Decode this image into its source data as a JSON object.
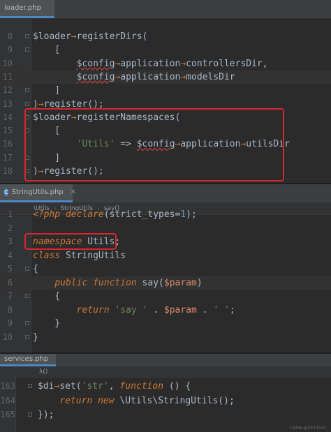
{
  "panes": [
    {
      "tab": {
        "label": "loader.php",
        "icon": "php-file-icon",
        "close": "✕"
      },
      "lines": [
        {
          "num": "8",
          "code": "$loader->registerDirs("
        },
        {
          "num": "9",
          "code": "    ["
        },
        {
          "num": "10",
          "code": "        $config->application->controllersDir,"
        },
        {
          "num": "11",
          "code": "        $config->application->modelsDir"
        },
        {
          "num": "12",
          "code": "    ]"
        },
        {
          "num": "13",
          "code": ")->register();"
        },
        {
          "num": "14",
          "code": "$loader->registerNamespaces("
        },
        {
          "num": "15",
          "code": "    ["
        },
        {
          "num": "16",
          "code": "        'Utils' => $config->application->utilsDir"
        },
        {
          "num": "17",
          "code": "    ]"
        },
        {
          "num": "18",
          "code": ")->register();"
        }
      ]
    },
    {
      "tab": {
        "label": "StringUtils.php",
        "icon": "class-file-icon",
        "icon_letter": "C",
        "close": "✕"
      },
      "breadcrumb": [
        "\\Utils",
        "StringUtils",
        "say()"
      ],
      "breadcrumb_sep": "›",
      "lines": [
        {
          "num": "1",
          "code": "<?php declare(strict_types=1);"
        },
        {
          "num": "2",
          "code": ""
        },
        {
          "num": "3",
          "code": "namespace Utils;"
        },
        {
          "num": "4",
          "code": "class StringUtils"
        },
        {
          "num": "5",
          "code": "{"
        },
        {
          "num": "6",
          "code": "    public function say($param)"
        },
        {
          "num": "7",
          "code": "    {"
        },
        {
          "num": "8",
          "code": "        return 'say ' . $param . ' ';"
        },
        {
          "num": "9",
          "code": "    }"
        },
        {
          "num": "10",
          "code": "}"
        }
      ]
    },
    {
      "tab": {
        "label": "services.php",
        "icon": "php-file-icon",
        "close": "✕"
      },
      "breadcrumb": [
        "λ()"
      ],
      "lines": [
        {
          "num": "163",
          "code": "$di->set('str', function () {"
        },
        {
          "num": "164",
          "code": "    return new \\Utils\\StringUtils();"
        },
        {
          "num": "165",
          "code": "});"
        }
      ]
    }
  ],
  "watermark": "CSDN @3333333_",
  "colors": {
    "highlight": "#d8262b",
    "keyword": "#cc7832",
    "string": "#6a8759",
    "number": "#6897bb"
  }
}
